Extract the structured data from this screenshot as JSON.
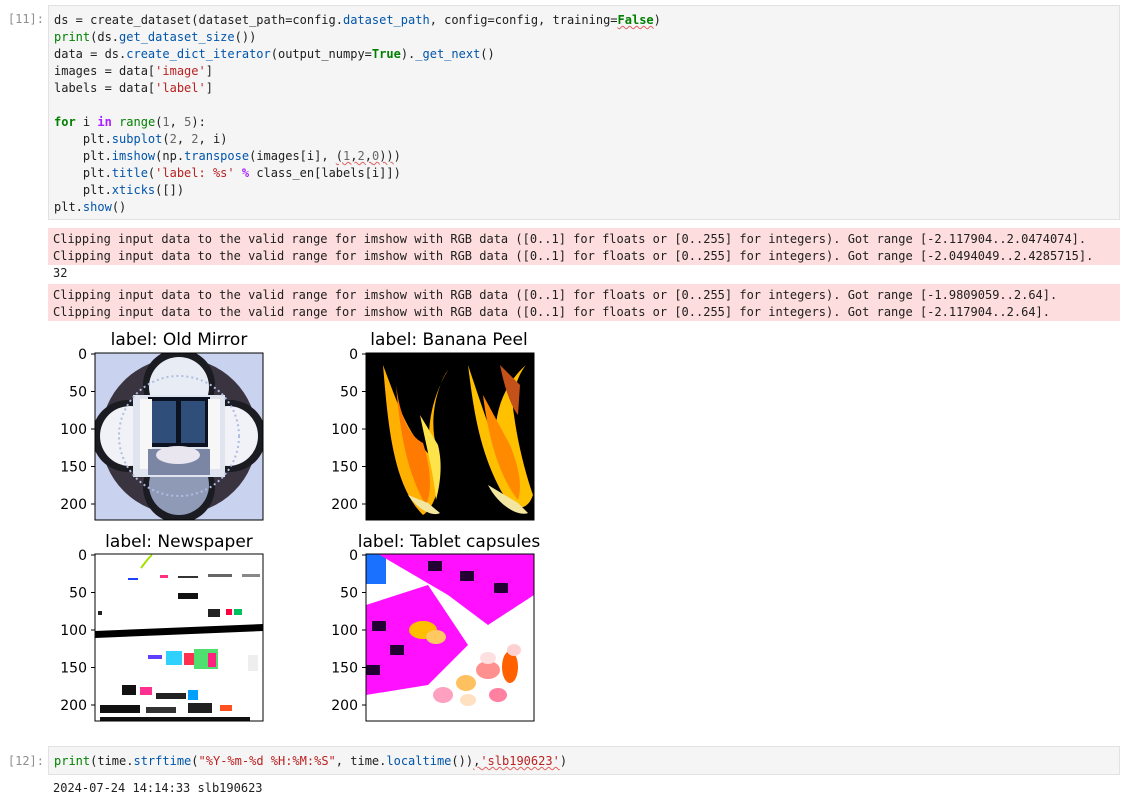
{
  "cell11": {
    "prompt": "[11]:",
    "stderr_block1": [
      "Clipping input data to the valid range for imshow with RGB data ([0..1] for floats or [0..255] for integers). Got range [-2.117904..2.0474074].",
      "Clipping input data to the valid range for imshow with RGB data ([0..1] for floats or [0..255] for integers). Got range [-2.0494049..2.4285715]."
    ],
    "stdout": "32",
    "stderr_block2": [
      "Clipping input data to the valid range for imshow with RGB data ([0..1] for floats or [0..255] for integers). Got range [-1.9809059..2.64].",
      "Clipping input data to the valid range for imshow with RGB data ([0..1] for floats or [0..255] for integers). Got range [-2.117904..2.64]."
    ],
    "subplots": [
      {
        "title": "label: Old Mirror",
        "ticks": [
          "0",
          "50",
          "100",
          "150",
          "200"
        ]
      },
      {
        "title": "label: Banana Peel",
        "ticks": [
          "0",
          "50",
          "100",
          "150",
          "200"
        ]
      },
      {
        "title": "label: Newspaper",
        "ticks": [
          "0",
          "50",
          "100",
          "150",
          "200"
        ]
      },
      {
        "title": "label: Tablet capsules",
        "ticks": [
          "0",
          "50",
          "100",
          "150",
          "200"
        ]
      }
    ]
  },
  "cell12": {
    "prompt": "[12]:",
    "output": "2024-07-24 14:14:33 slb190623"
  },
  "colors": {
    "stderr_bg": "#fddddd",
    "cell_bg": "#f5f5f5",
    "keyword": "#008000",
    "string": "#ba2121"
  }
}
